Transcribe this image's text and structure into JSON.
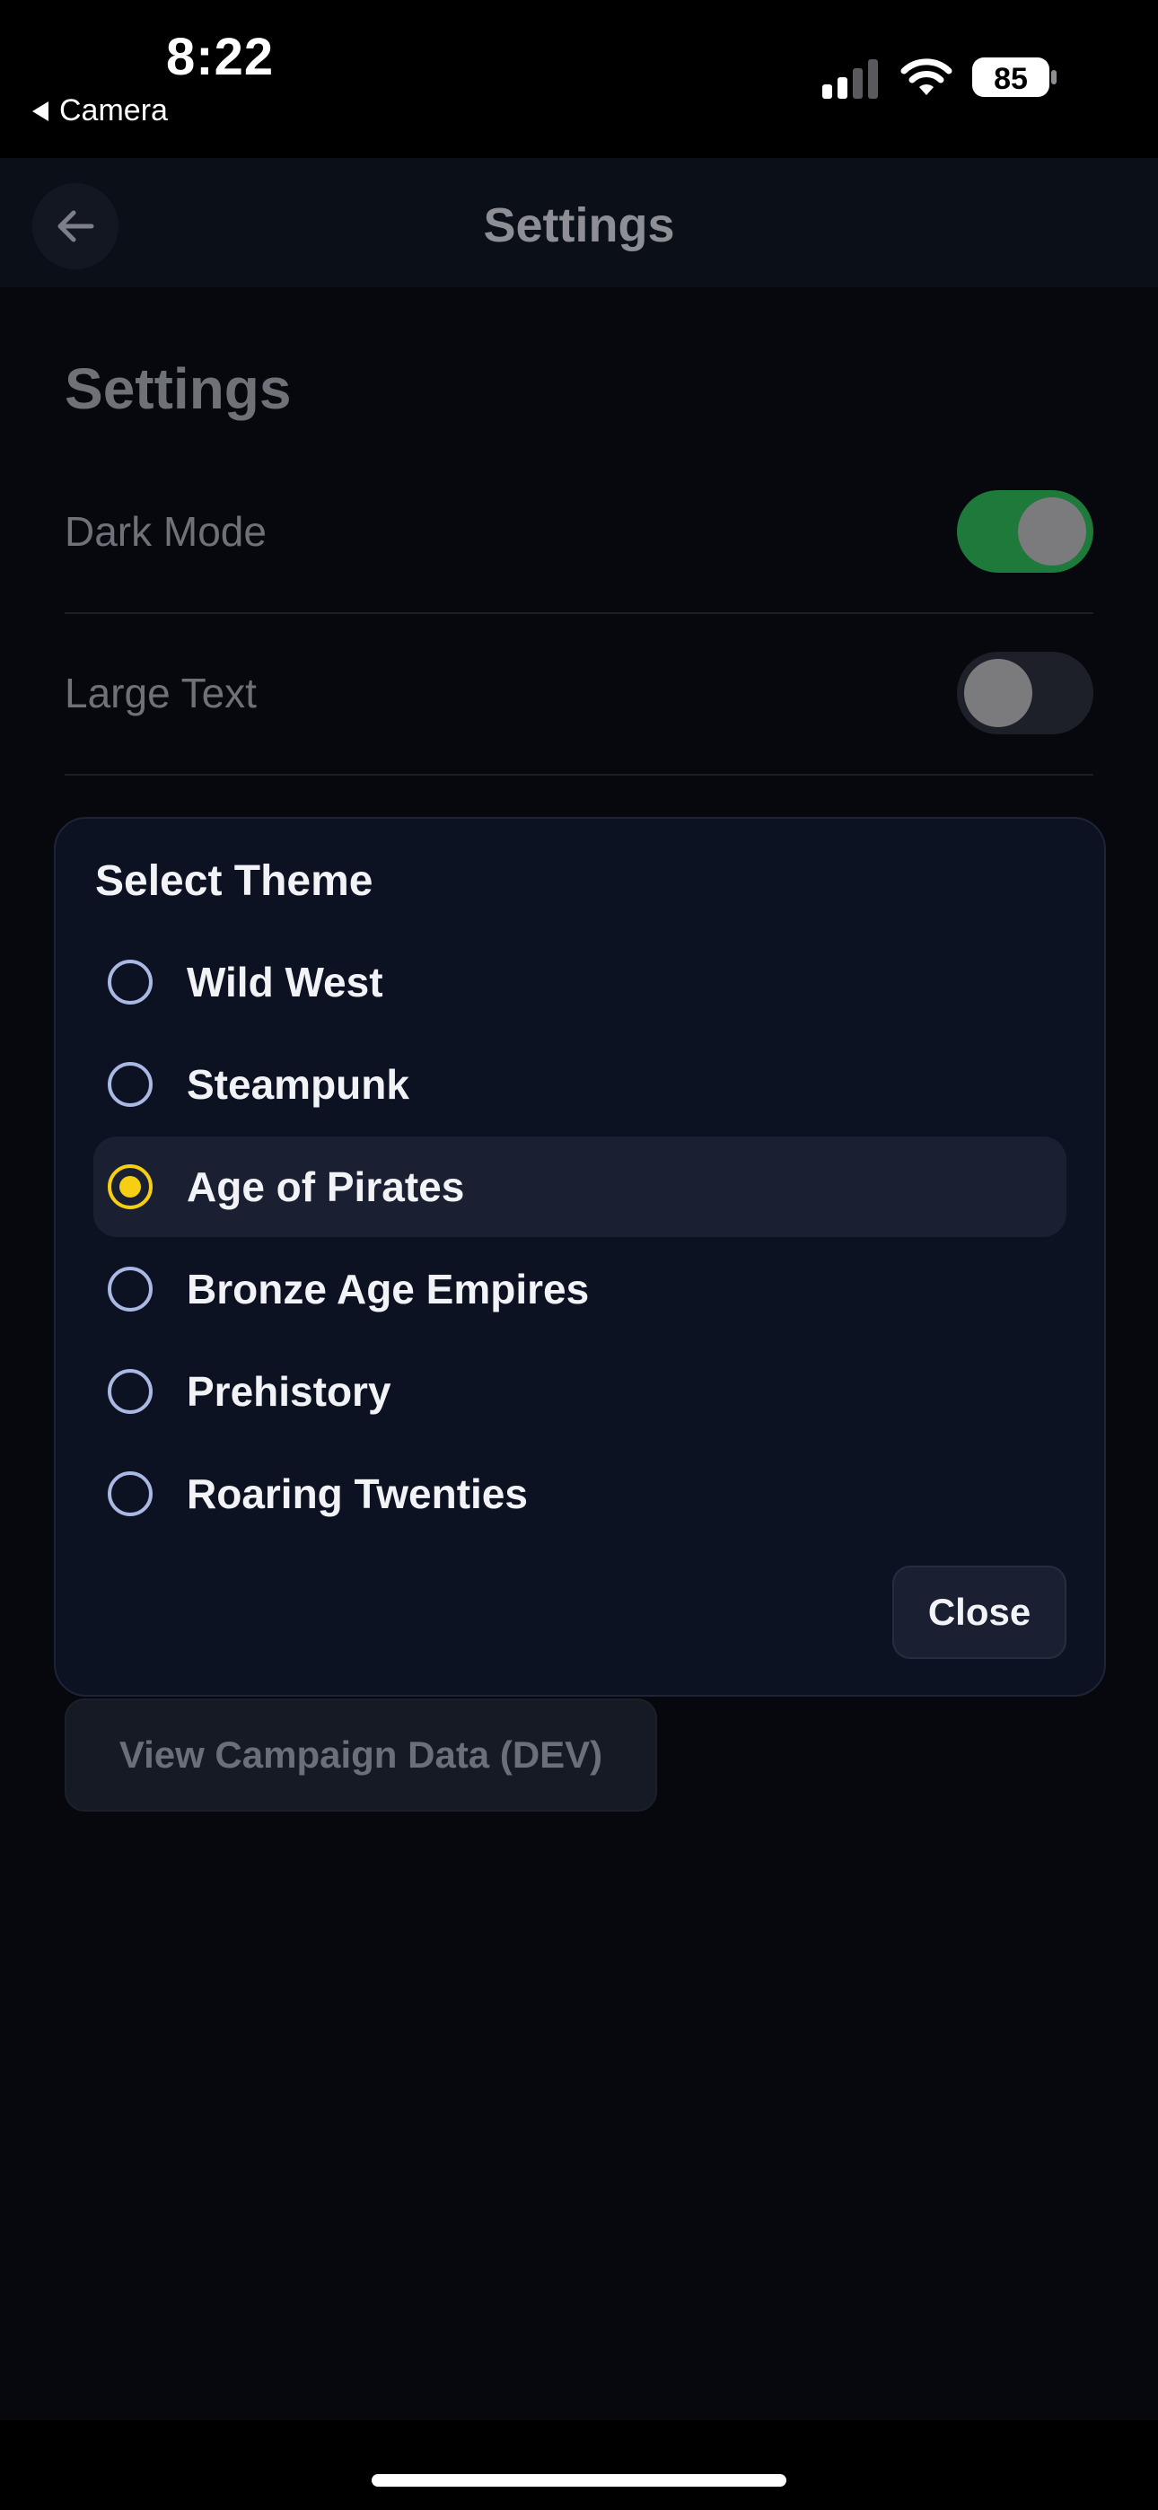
{
  "status_bar": {
    "time": "8:22",
    "back_app": "Camera",
    "battery_level": "85"
  },
  "header": {
    "title": "Settings",
    "back_icon": "arrow-left-icon"
  },
  "page": {
    "heading": "Settings",
    "settings": [
      {
        "label": "Dark Mode",
        "enabled": true
      },
      {
        "label": "Large Text",
        "enabled": false
      }
    ],
    "dev_button_label": "View Campaign Data (DEV)"
  },
  "theme_modal": {
    "title": "Select Theme",
    "options": [
      {
        "label": "Wild West",
        "selected": false
      },
      {
        "label": "Steampunk",
        "selected": false
      },
      {
        "label": "Age of Pirates",
        "selected": true
      },
      {
        "label": "Bronze Age Empires",
        "selected": false
      },
      {
        "label": "Prehistory",
        "selected": false
      },
      {
        "label": "Roaring Twenties",
        "selected": false
      }
    ],
    "close_label": "Close"
  },
  "colors": {
    "accent_selected": "#f6cf12",
    "toggle_on": "#1d7a3b",
    "modal_bg": "#0d1223"
  }
}
